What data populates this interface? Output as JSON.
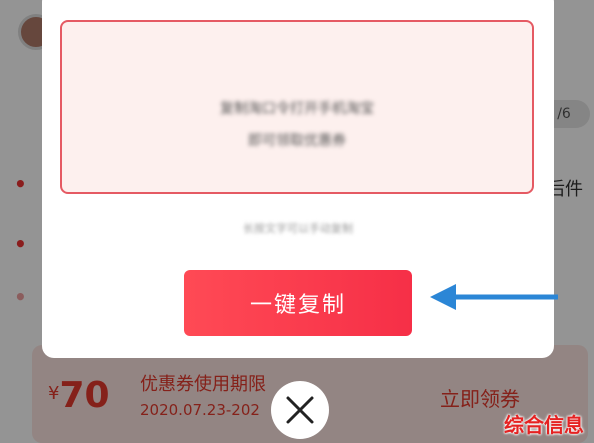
{
  "background": {
    "counter": "/6",
    "side_text": "后件",
    "coupon": {
      "currency": "¥",
      "amount": "70",
      "title": "优惠券使用期限",
      "date": "2020.07.23-202",
      "claim_label": "立即领券"
    }
  },
  "modal": {
    "blurred_line_1": "复制淘口令打开手机淘宝",
    "blurred_line_2": "即可领取优惠券",
    "blurred_hint": "长按文字可以手动复制",
    "copy_button_label": "一键复制"
  },
  "icons": {
    "close": "close-icon",
    "arrow": "arrow-left-icon"
  },
  "watermark": "综合信息",
  "colors": {
    "accent": "#f62f47",
    "box_border": "#e55a63",
    "arrow": "#2b86d6"
  }
}
